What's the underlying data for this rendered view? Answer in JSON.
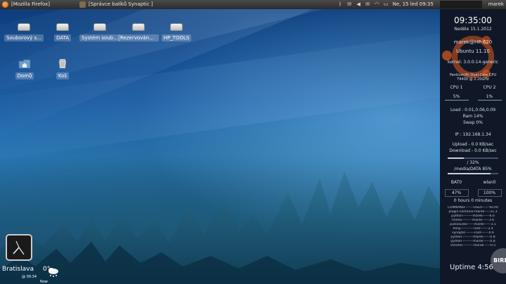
{
  "top_panel": {
    "tasks": [
      {
        "label": "[Mozilla Firefox]",
        "icon": "firefox-icon"
      },
      {
        "label": "[Správce balíků Synaptic ]",
        "icon": "synaptic-icon"
      }
    ],
    "datetime": "Ne, 15 led  09:35",
    "user": "marek"
  },
  "desktop_icons": [
    {
      "label": "Souborový s...",
      "icon": "drive-icon"
    },
    {
      "label": "DATA",
      "icon": "drive-icon"
    },
    {
      "label": "Systém soub...",
      "icon": "drive-icon"
    },
    {
      "label": "Rezervováno ...",
      "icon": "drive-icon"
    },
    {
      "label": "HP_TOOLS",
      "icon": "drive-icon"
    },
    {
      "label": "Domů",
      "icon": "home-folder-icon"
    },
    {
      "label": "Koš",
      "icon": "trash-icon"
    }
  ],
  "conky": {
    "time": "09:35:00",
    "date": "Neděle 15.1.2012",
    "host": "marek@HP-620",
    "os": "Ubuntu 11.10",
    "kernel": "kernel: 3.0.0-14-generic",
    "cpu_model": "Pentium(R) Dual-Core CPU",
    "cpu_freq": "T4400  @ 2.20GHz",
    "cpu1_label": "CPU 1",
    "cpu1_value": "5%",
    "cpu2_label": "CPU 2",
    "cpu2_value": "1%",
    "load": "Load : 0.01,0.06,0.09",
    "ram": "Ram 14%",
    "swap": "Swap 0%",
    "ip": "IP : 192.168.1.34",
    "upload": "Upload - 0.0 KB/sec",
    "download": "Download - 0.0 KB/sec",
    "disk_root": "/ 32%",
    "disk_root_fraction": 0.32,
    "disk_data": "/media/DATA 85%",
    "disk_data_fraction": 0.85,
    "bat_label": "BAT0",
    "bat_value": "47%",
    "wlan_label": "wlan0",
    "wlan_value": "100%",
    "battery_time": "0 hours 0 minutes",
    "proc_header": "COMMAND--------USER------%CPU",
    "processes": [
      "plugin-containe-marek-----21.3",
      "python---------marek------6.0",
      "firefox---------marek------3.6",
      "pulseaudio------marek------3.1",
      "Xorg------------root-------2.4",
      "synaptic--------root-------0.9",
      "python----------marek------0.8",
      "python----------marek------0.8",
      "chrome----------marek------0.5"
    ],
    "uptime": "Uptime 4:56",
    "watermark": "BIRDZ"
  },
  "weather": {
    "city": "Bratislava",
    "time": "@ 09:34",
    "temp": "0°",
    "condition": "Now"
  },
  "colors": {
    "panel": "#2b2b2b",
    "conky_bg": "#101828",
    "ubuntu_orange": "#e05a1c"
  }
}
